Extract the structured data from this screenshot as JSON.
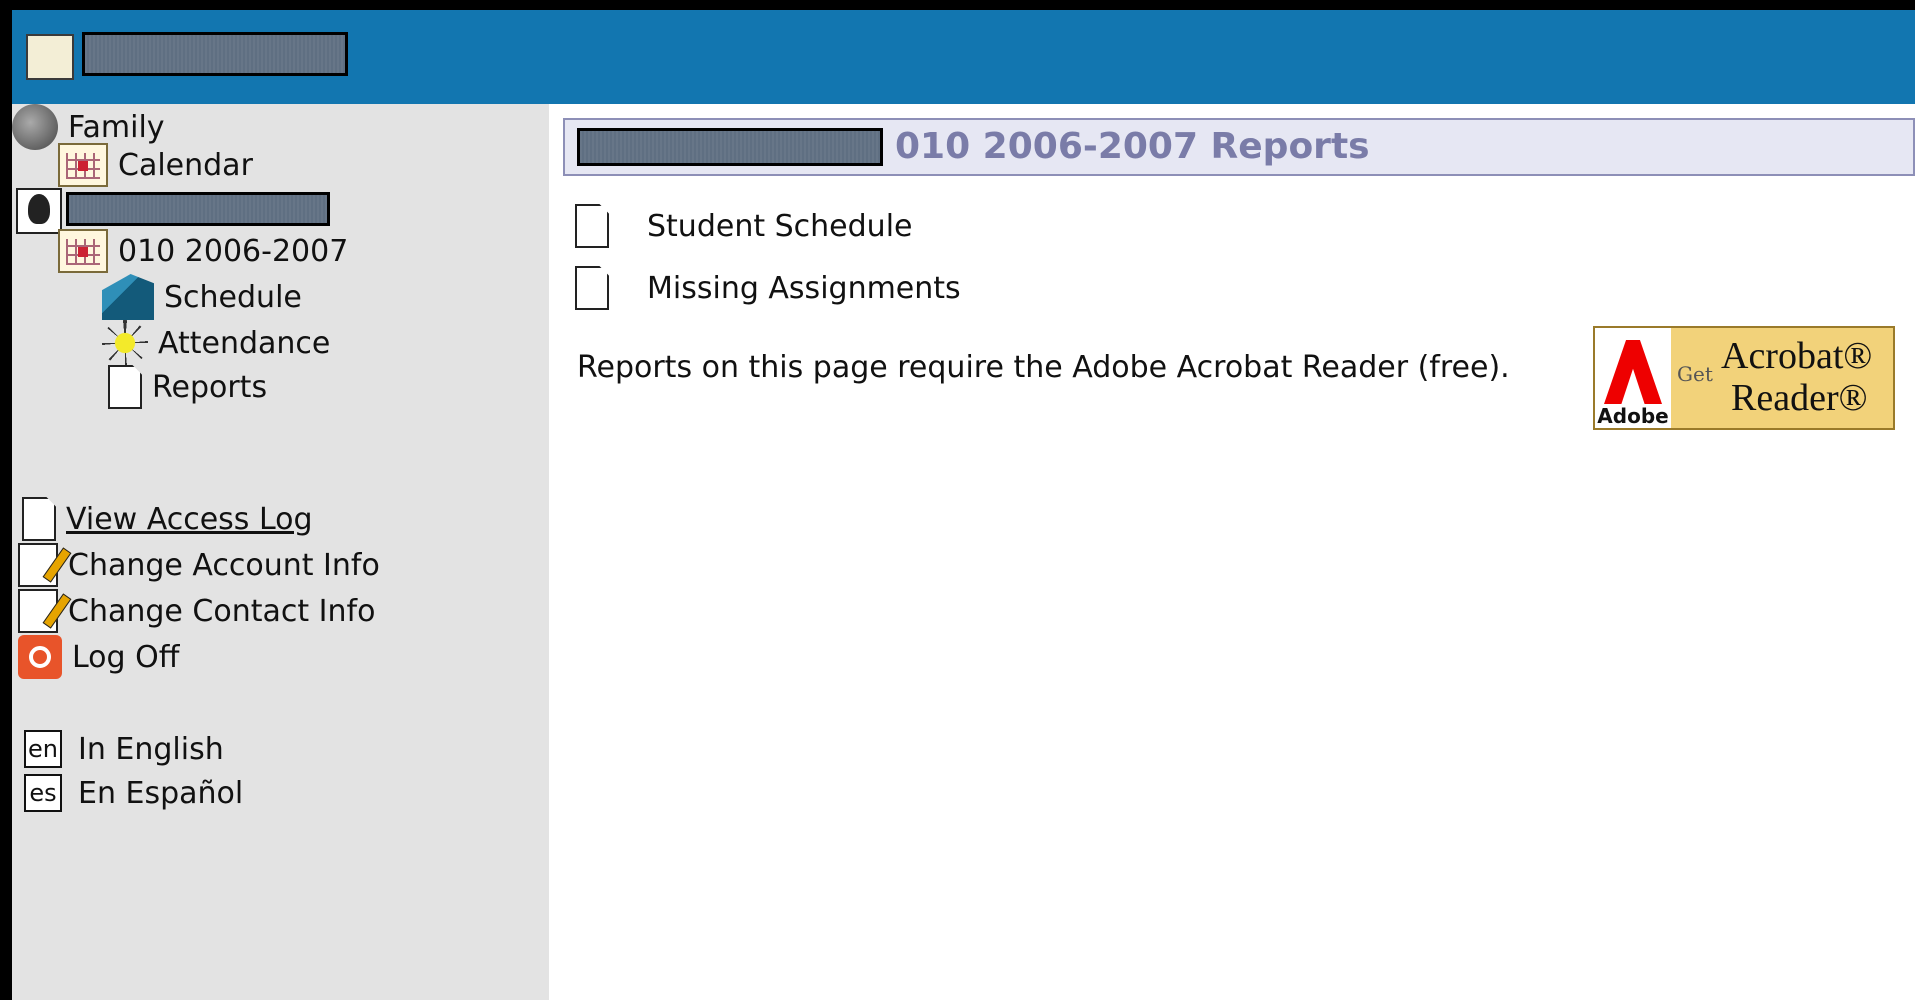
{
  "sidebar": {
    "family_label": "Family",
    "calendar_label": "Calendar",
    "term_label": "010 2006-2007",
    "schedule_label": "Schedule",
    "attendance_label": "Attendance",
    "reports_label": "Reports",
    "view_access_log": "View Access Log",
    "change_account_info": "Change Account Info",
    "change_contact_info": "Change Contact Info",
    "log_off": "Log Off",
    "lang_en_code": "en",
    "lang_en_label": "In English",
    "lang_es_code": "es",
    "lang_es_label": "En Español"
  },
  "main": {
    "title": "010 2006-2007 Reports",
    "reports": [
      {
        "label": "Student Schedule"
      },
      {
        "label": "Missing Assignments"
      }
    ],
    "notice": "Reports on this page require the Adobe Acrobat Reader (free).",
    "badge": {
      "adobe": "Adobe",
      "get": "Get",
      "line1": "Acrobat®",
      "line2": "Reader®"
    }
  },
  "colors": {
    "header": "#1276b0",
    "sidebar": "#e3e3e3",
    "title_text": "#7a7ca8",
    "title_bar": "#e6e7f3"
  },
  "icons": [
    "app-logo-icon",
    "globe-family-icon",
    "calendar-icon",
    "student-icon",
    "building-icon",
    "sun-icon",
    "document-icon",
    "edit-icon",
    "power-icon",
    "language-icon"
  ]
}
